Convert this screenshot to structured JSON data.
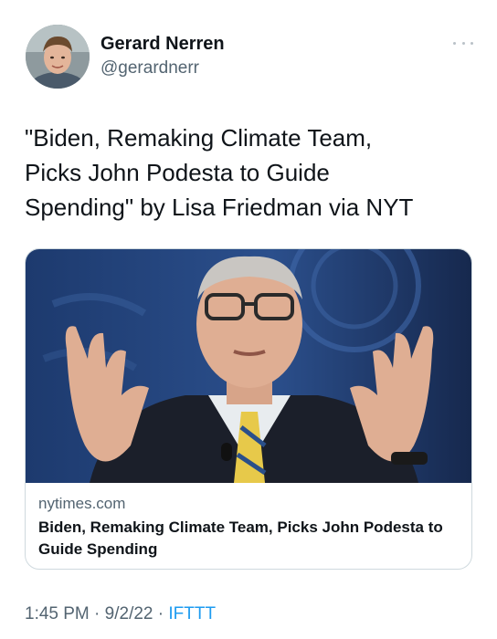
{
  "user": {
    "display_name": "Gerard Nerren",
    "handle": "@gerardnerr",
    "avatar_icon": "profile-photo"
  },
  "menu": {
    "icon": "more-dots-icon"
  },
  "tweet": {
    "text": "\"Biden, Remaking Climate Team,\nPicks John Podesta to Guide\nSpending\" by Lisa Friedman via NYT"
  },
  "card": {
    "image_icon": "article-photo",
    "domain": "nytimes.com",
    "title": "Biden, Remaking Climate Team, Picks John Podesta to Guide Spending"
  },
  "meta": {
    "time": "1:45 PM",
    "sep1": " · ",
    "date": "9/2/22",
    "sep2": " · ",
    "source": "IFTTT"
  },
  "colors": {
    "text": "#0f1419",
    "secondary": "#536471",
    "link": "#1d9bf0",
    "border": "#cfd9de"
  }
}
